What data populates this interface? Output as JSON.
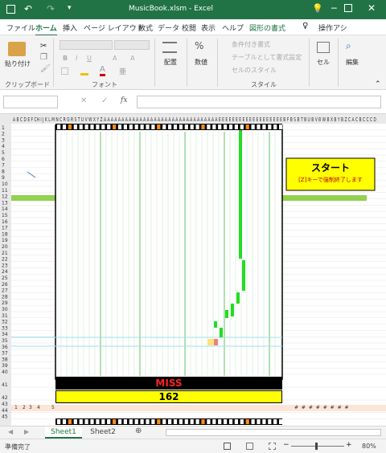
{
  "window": {
    "title": "MusicBook.xlsm  -  Excel"
  },
  "ribbon_tabs": [
    "ファイル",
    "ホーム",
    "挿入",
    "ページ レイアウト",
    "数式",
    "データ",
    "校閲",
    "表示",
    "ヘルプ",
    "図形の書式"
  ],
  "tell_me": "操作アシ",
  "groups": {
    "clipboard": {
      "label": "クリップボード",
      "paste": "貼り付け"
    },
    "font": {
      "label": "フォント"
    },
    "alignment": {
      "label": "配置"
    },
    "number": {
      "label": "数値"
    },
    "styles": {
      "label": "スタイル",
      "conditional": "条件付き書式",
      "table": "テーブルとして書式設定",
      "cell_styles": "セルのスタイル"
    },
    "cells": {
      "label": "セル"
    },
    "editing": {
      "label": "編集"
    }
  },
  "formula_bar": {
    "name_box": "",
    "formula": "",
    "fx": "fx"
  },
  "column_headers": "A B C D E F CH I J K L M N C R G R S T U V W X Y Z A A A A A A A A A A A A A A A A A A A A A A A A A A A A A A A A E E E E E E E E E E E E E E E E E E E B F B S B T B U B V B W B X B Y B Z C A C B C C C D",
  "row_numbers": [
    "1",
    "2",
    "3",
    "4",
    "5",
    "6",
    "7",
    "8",
    "9",
    "10",
    "11",
    "12",
    "13",
    "14",
    "15",
    "16",
    "17",
    "18",
    "19",
    "20",
    "21",
    "22",
    "23",
    "24",
    "25",
    "26",
    "27",
    "28",
    "29",
    "30",
    "31",
    "32",
    "33",
    "34",
    "35",
    "36",
    "37",
    "38",
    "39",
    "40",
    "41",
    "42",
    "43",
    "44",
    "45"
  ],
  "game": {
    "start_button": "スタート",
    "start_hint": "[Z]キーで強制終了します",
    "judgment": "MISS",
    "score": "162",
    "row43_numbers": [
      "1",
      "2",
      "3",
      "4",
      "5"
    ],
    "row43_hashes": "# # # # # # # #"
  },
  "sheets": [
    "Sheet1",
    "Sheet2"
  ],
  "status": {
    "ready": "準備完了",
    "zoom": "80%"
  },
  "colors": {
    "excel_green": "#217346",
    "note_green": "#22dd22",
    "miss_red": "#ff2222",
    "score_yellow": "#ffff00",
    "lane_line": "#9fd59f"
  }
}
